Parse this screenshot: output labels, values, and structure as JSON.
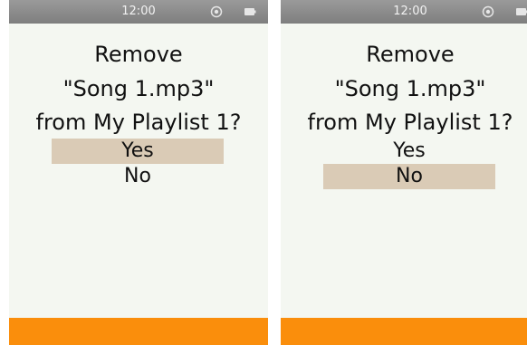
{
  "colors": {
    "status_bar": "#8a8a8a",
    "screen_background": "#f4f7f1",
    "selection_highlight": "#dacbb6",
    "bottom_bar": "#fa8e0c"
  },
  "screens": [
    {
      "status": {
        "time": "12:00",
        "icons": [
          "target-icon",
          "battery-icon"
        ]
      },
      "prompt": {
        "line1": "Remove",
        "line2": "\"Song 1.mp3\"",
        "line3": "from My Playlist 1?"
      },
      "options": {
        "yes": "Yes",
        "no": "No"
      },
      "selected_option": "Yes"
    },
    {
      "status": {
        "time": "12:00",
        "icons": [
          "target-icon",
          "battery-icon"
        ]
      },
      "prompt": {
        "line1": "Remove",
        "line2": "\"Song 1.mp3\"",
        "line3": "from My Playlist 1?"
      },
      "options": {
        "yes": "Yes",
        "no": "No"
      },
      "selected_option": "No"
    }
  ]
}
